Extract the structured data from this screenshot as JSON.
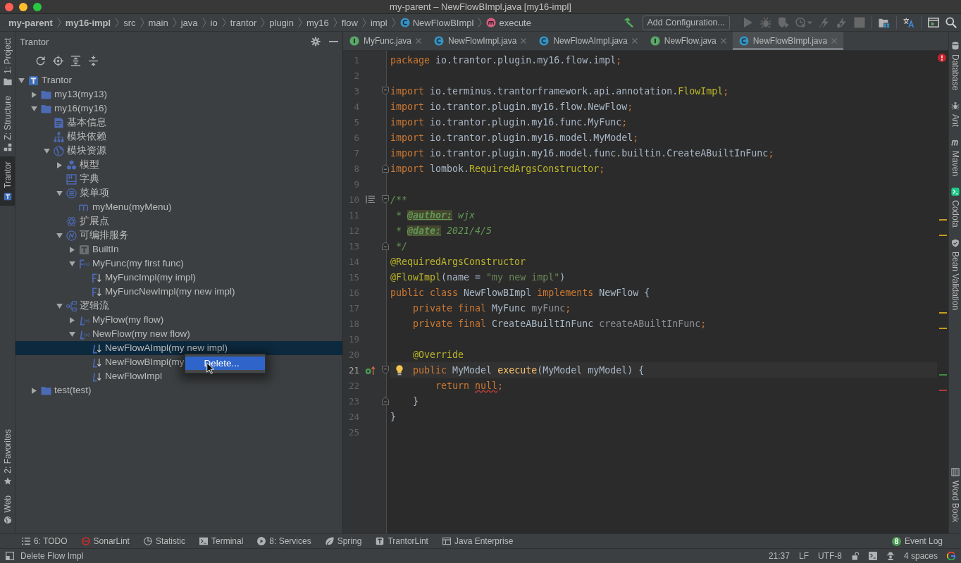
{
  "window": {
    "title": "my-parent – NewFlowBImpl.java [my16-impl]"
  },
  "navigation_bar": {
    "breadcrumbs": [
      {
        "label": "my-parent",
        "kind": "project"
      },
      {
        "label": "my16-impl",
        "kind": "module"
      },
      {
        "label": "src",
        "kind": "folder"
      },
      {
        "label": "main",
        "kind": "folder"
      },
      {
        "label": "java",
        "kind": "folder"
      },
      {
        "label": "io",
        "kind": "folder"
      },
      {
        "label": "trantor",
        "kind": "folder"
      },
      {
        "label": "plugin",
        "kind": "folder"
      },
      {
        "label": "my16",
        "kind": "folder"
      },
      {
        "label": "flow",
        "kind": "folder"
      },
      {
        "label": "impl",
        "kind": "folder"
      },
      {
        "label": "NewFlowBImpl",
        "kind": "class"
      },
      {
        "label": "execute",
        "kind": "method"
      }
    ],
    "actions": [
      {
        "kind": "build",
        "disabled": false
      },
      {
        "kind": "configuration",
        "label": "Add Configuration...",
        "disabled": false
      },
      {
        "kind": "run",
        "disabled": true
      },
      {
        "kind": "debug",
        "disabled": true
      },
      {
        "kind": "coverage",
        "disabled": true
      },
      {
        "kind": "profile",
        "disabled": true
      },
      {
        "kind": "attach",
        "disabled": true
      },
      {
        "kind": "attach-debug",
        "disabled": true
      },
      {
        "kind": "stop",
        "disabled": true
      },
      {
        "kind": "project-structure",
        "disabled": false
      },
      {
        "kind": "translate",
        "disabled": false
      },
      {
        "kind": "run-window",
        "disabled": false
      },
      {
        "kind": "search",
        "disabled": false
      }
    ]
  },
  "left_tool_bar": {
    "top": [
      {
        "label": "1: Project",
        "kind": "project",
        "selected": false
      },
      {
        "label": "Z: Structure",
        "kind": "structure",
        "selected": false
      },
      {
        "label": "Trantor",
        "kind": "trantor",
        "selected": true
      }
    ],
    "bottom": [
      {
        "label": "2: Favorites",
        "kind": "favorites",
        "selected": false
      },
      {
        "label": "Web",
        "kind": "web",
        "selected": false
      }
    ]
  },
  "project_panel": {
    "title": "Trantor",
    "tree": [
      {
        "label": "Trantor",
        "kind": "trantor",
        "expanded": true,
        "selected": false,
        "children": [
          {
            "label": "my13(my13)",
            "kind": "folder",
            "expanded": false,
            "selected": false
          },
          {
            "label": "my16(my16)",
            "kind": "folder",
            "expanded": true,
            "selected": false,
            "children": [
              {
                "label": "基本信息",
                "kind": "info",
                "selected": false
              },
              {
                "label": "模块依赖",
                "kind": "dependency",
                "selected": false
              },
              {
                "label": "模块资源",
                "kind": "resources",
                "expanded": true,
                "selected": false,
                "children": [
                  {
                    "label": "模型",
                    "kind": "model",
                    "expanded": false,
                    "selected": false
                  },
                  {
                    "label": "字典",
                    "kind": "dictionary",
                    "selected": false
                  },
                  {
                    "label": "菜单项",
                    "kind": "menu",
                    "expanded": true,
                    "selected": false,
                    "children": [
                      {
                        "label": "myMenu(myMenu)",
                        "kind": "menu-item",
                        "selected": false
                      }
                    ]
                  },
                  {
                    "label": "扩展点",
                    "kind": "extension",
                    "selected": false
                  },
                  {
                    "label": "可编排服务",
                    "kind": "service",
                    "expanded": true,
                    "selected": false,
                    "children": [
                      {
                        "label": "BuiltIn",
                        "kind": "builtin",
                        "expanded": false,
                        "selected": false
                      },
                      {
                        "label": "MyFunc(my first func)",
                        "kind": "function",
                        "expanded": true,
                        "selected": false,
                        "children": [
                          {
                            "label": "MyFuncImpl(my impl)",
                            "kind": "function-impl",
                            "selected": false
                          },
                          {
                            "label": "MyFuncNewImpl(my new impl)",
                            "kind": "function-impl",
                            "selected": false
                          }
                        ]
                      }
                    ]
                  },
                  {
                    "label": "逻辑流",
                    "kind": "flows",
                    "expanded": true,
                    "selected": false,
                    "children": [
                      {
                        "label": "MyFlow(my flow)",
                        "kind": "flow",
                        "expanded": false,
                        "selected": false
                      },
                      {
                        "label": "NewFlow(my new flow)",
                        "kind": "flow",
                        "expanded": true,
                        "selected": false,
                        "children": [
                          {
                            "label": "NewFlowAImpl(my new impl)",
                            "kind": "flow-impl",
                            "selected": true
                          },
                          {
                            "label": "NewFlowBImpl(my",
                            "kind": "flow-impl",
                            "selected": false,
                            "context_menu": [
                              {
                                "label": "Delete...",
                                "selected": true
                              }
                            ]
                          },
                          {
                            "label": "NewFlowImpl",
                            "kind": "flow-impl",
                            "selected": false
                          }
                        ]
                      }
                    ]
                  }
                ]
              }
            ]
          },
          {
            "label": "test(test)",
            "kind": "folder",
            "expanded": false,
            "selected": false
          }
        ]
      }
    ]
  },
  "editor": {
    "tabs": [
      {
        "label": "MyFunc.java",
        "kind": "interface",
        "selected": false
      },
      {
        "label": "NewFlowImpl.java",
        "kind": "class",
        "selected": false
      },
      {
        "label": "NewFlowAImpl.java",
        "kind": "class",
        "selected": false
      },
      {
        "label": "NewFlow.java",
        "kind": "interface",
        "selected": false
      },
      {
        "label": "NewFlowBImpl.java",
        "kind": "class",
        "selected": true
      }
    ],
    "has_errors": true,
    "lines": [
      {
        "number": "1",
        "current": false,
        "tokens": [
          {
            "kind": "keyword",
            "text": "package"
          },
          {
            "kind": "plain",
            "text": " io.trantor.plugin.my16.flow.impl"
          },
          {
            "kind": "punct",
            "text": ";"
          }
        ]
      },
      {
        "number": "2",
        "current": false
      },
      {
        "number": "3",
        "current": false,
        "marks": [
          {
            "kind": "fold-start"
          }
        ],
        "tokens": [
          {
            "kind": "keyword",
            "text": "import"
          },
          {
            "kind": "plain",
            "text": " io.terminus.trantorframework.api.annotation."
          },
          {
            "kind": "annotation",
            "text": "FlowImpl"
          },
          {
            "kind": "punct",
            "text": ";"
          }
        ]
      },
      {
        "number": "4",
        "current": false,
        "tokens": [
          {
            "kind": "keyword",
            "text": "import"
          },
          {
            "kind": "plain",
            "text": " io.trantor.plugin.my16.flow.NewFlow"
          },
          {
            "kind": "punct",
            "text": ";"
          }
        ]
      },
      {
        "number": "5",
        "current": false,
        "tokens": [
          {
            "kind": "keyword",
            "text": "import"
          },
          {
            "kind": "plain",
            "text": " io.trantor.plugin.my16.func.MyFunc"
          },
          {
            "kind": "punct",
            "text": ";"
          }
        ]
      },
      {
        "number": "6",
        "current": false,
        "tokens": [
          {
            "kind": "keyword",
            "text": "import"
          },
          {
            "kind": "plain",
            "text": " io.trantor.plugin.my16.model.MyModel"
          },
          {
            "kind": "punct",
            "text": ";"
          }
        ]
      },
      {
        "number": "7",
        "current": false,
        "tokens": [
          {
            "kind": "keyword",
            "text": "import"
          },
          {
            "kind": "plain",
            "text": " io.trantor.plugin.my16.model.func.builtin.CreateABuiltInFunc"
          },
          {
            "kind": "punct",
            "text": ";"
          }
        ]
      },
      {
        "number": "8",
        "current": false,
        "marks": [
          {
            "kind": "fold-end"
          }
        ],
        "tokens": [
          {
            "kind": "keyword",
            "text": "import"
          },
          {
            "kind": "plain",
            "text": " lombok."
          },
          {
            "kind": "annotation",
            "text": "RequiredArgsConstructor"
          },
          {
            "kind": "punct",
            "text": ";"
          }
        ]
      },
      {
        "number": "9",
        "current": false
      },
      {
        "number": "10",
        "current": false,
        "marks": [
          {
            "kind": "render-doc"
          },
          {
            "kind": "fold-start"
          }
        ],
        "tokens": [
          {
            "kind": "doc",
            "text": "/**"
          }
        ]
      },
      {
        "number": "11",
        "current": false,
        "marks": [
          {
            "kind": "stripe",
            "color": "#c79b1c"
          }
        ],
        "tokens": [
          {
            "kind": "doc",
            "text": " * "
          },
          {
            "kind": "doctag",
            "text": "@author:"
          },
          {
            "kind": "doc",
            "text": " wjx"
          }
        ]
      },
      {
        "number": "12",
        "current": false,
        "marks": [
          {
            "kind": "stripe",
            "color": "#c79b1c"
          }
        ],
        "tokens": [
          {
            "kind": "doc",
            "text": " * "
          },
          {
            "kind": "doctag",
            "text": "@date:"
          },
          {
            "kind": "doc",
            "text": " 2021/4/5"
          }
        ]
      },
      {
        "number": "13",
        "current": false,
        "marks": [
          {
            "kind": "fold-end"
          }
        ],
        "tokens": [
          {
            "kind": "doc",
            "text": " */"
          }
        ]
      },
      {
        "number": "14",
        "current": false,
        "tokens": [
          {
            "kind": "annotation",
            "text": "@RequiredArgsConstructor"
          }
        ]
      },
      {
        "number": "15",
        "current": false,
        "tokens": [
          {
            "kind": "annotation",
            "text": "@FlowImpl"
          },
          {
            "kind": "plain",
            "text": "(name = "
          },
          {
            "kind": "string",
            "text": "\"my new impl\""
          },
          {
            "kind": "plain",
            "text": ")"
          }
        ]
      },
      {
        "number": "16",
        "current": false,
        "tokens": [
          {
            "kind": "keyword",
            "text": "public class"
          },
          {
            "kind": "plain",
            "text": " NewFlowBImpl "
          },
          {
            "kind": "keyword",
            "text": "implements"
          },
          {
            "kind": "plain",
            "text": " NewFlow {"
          }
        ]
      },
      {
        "number": "17",
        "current": false,
        "marks": [
          {
            "kind": "stripe",
            "color": "#c79b1c"
          }
        ],
        "tokens": [
          {
            "kind": "keyword",
            "text": "    private final"
          },
          {
            "kind": "plain",
            "text": " MyFunc "
          },
          {
            "kind": "unused",
            "text": "myFunc"
          },
          {
            "kind": "punct",
            "text": ";"
          }
        ]
      },
      {
        "number": "18",
        "current": false,
        "marks": [
          {
            "kind": "stripe",
            "color": "#c79b1c"
          }
        ],
        "tokens": [
          {
            "kind": "keyword",
            "text": "    private final"
          },
          {
            "kind": "plain",
            "text": " CreateABuiltInFunc "
          },
          {
            "kind": "unused",
            "text": "createABuiltInFunc"
          },
          {
            "kind": "punct",
            "text": ";"
          }
        ]
      },
      {
        "number": "19",
        "current": false
      },
      {
        "number": "20",
        "current": false,
        "tokens": [
          {
            "kind": "annotation",
            "text": "    @Override"
          }
        ]
      },
      {
        "number": "21",
        "current": true,
        "marks": [
          {
            "kind": "implements"
          },
          {
            "kind": "fold-start"
          },
          {
            "kind": "bulb"
          },
          {
            "kind": "stripe",
            "color": "#3f8f3f"
          }
        ],
        "tokens": [
          {
            "kind": "keyword",
            "text": "    public"
          },
          {
            "kind": "plain",
            "text": " MyModel "
          },
          {
            "kind": "method",
            "text": "execute"
          },
          {
            "kind": "plain",
            "text": "(MyModel myModel) {"
          }
        ]
      },
      {
        "number": "22",
        "current": false,
        "marks": [
          {
            "kind": "stripe",
            "color": "#b8393a"
          }
        ],
        "tokens": [
          {
            "kind": "keyword",
            "text": "        return "
          },
          {
            "kind": "flagged",
            "text": "null"
          },
          {
            "kind": "punct",
            "text": ";"
          }
        ]
      },
      {
        "number": "23",
        "current": false,
        "marks": [
          {
            "kind": "fold-end"
          }
        ],
        "tokens": [
          {
            "kind": "plain",
            "text": "    }"
          }
        ]
      },
      {
        "number": "24",
        "current": false,
        "tokens": [
          {
            "kind": "plain",
            "text": "}"
          }
        ]
      },
      {
        "number": "25",
        "current": false
      }
    ]
  },
  "right_tool_bar": {
    "top": [
      {
        "label": "Database",
        "kind": "database",
        "selected": false
      },
      {
        "label": "Ant",
        "kind": "ant",
        "selected": false
      },
      {
        "label": "Maven",
        "kind": "maven",
        "selected": false
      },
      {
        "label": "Codota",
        "kind": "codota",
        "selected": false
      },
      {
        "label": "Bean Validation",
        "kind": "bean-validation",
        "selected": false
      }
    ],
    "bottom": [
      {
        "label": "Word Book",
        "kind": "word-book",
        "selected": false
      }
    ]
  },
  "bottom_tool_bar": {
    "left": [
      {
        "label": "6: TODO",
        "kind": "todo",
        "selected": false
      },
      {
        "label": "SonarLint",
        "kind": "sonarlint",
        "selected": false
      },
      {
        "label": "Statistic",
        "kind": "statistic",
        "selected": false
      },
      {
        "label": "Terminal",
        "kind": "terminal",
        "selected": false
      },
      {
        "label": "8: Services",
        "kind": "services",
        "selected": false
      },
      {
        "label": "Spring",
        "kind": "spring",
        "selected": false
      },
      {
        "label": "TrantorLint",
        "kind": "trantorlint",
        "selected": false
      },
      {
        "label": "Java Enterprise",
        "kind": "java-enterprise",
        "selected": false
      }
    ],
    "right": [
      {
        "label": "Event Log",
        "kind": "event-log",
        "badge": "8",
        "selected": false
      }
    ]
  },
  "status_bar": {
    "message": "Delete Flow Impl",
    "widgets": [
      {
        "kind": "text",
        "label": "21:37"
      },
      {
        "kind": "text",
        "label": "LF"
      },
      {
        "kind": "text",
        "label": "UTF-8"
      },
      {
        "kind": "lock"
      },
      {
        "kind": "terminal"
      },
      {
        "kind": "inspector"
      },
      {
        "kind": "text",
        "label": "4 spaces"
      },
      {
        "kind": "google"
      }
    ]
  }
}
